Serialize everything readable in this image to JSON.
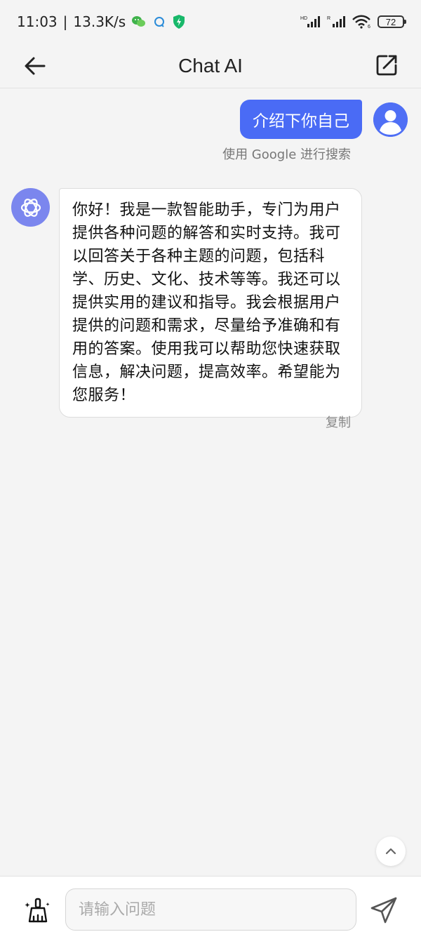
{
  "status_bar": {
    "time": "11:03",
    "separator": "|",
    "network_speed": "13.3K/s",
    "hd_label": "HD",
    "roaming_label": "R",
    "wifi_label": "6",
    "battery": "72"
  },
  "header": {
    "title": "Chat AI"
  },
  "chat": {
    "user_message": "介绍下你自己",
    "search_link": "使用 Google 进行搜索",
    "bot_message": "你好！我是一款智能助手，专门为用户提供各种问题的解答和实时支持。我可以回答关于各种主题的问题，包括科学、历史、文化、技术等等。我还可以提供实用的建议和指导。我会根据用户提供的问题和需求，尽量给予准确和有用的答案。使用我可以帮助您快速获取信息，解决问题，提高效率。希望能为您服务！",
    "copy_label": "复制"
  },
  "input": {
    "placeholder": "请输入问题",
    "value": ""
  },
  "colors": {
    "accent": "#4a6bf5",
    "bot_avatar": "#7b86ee",
    "background": "#f4f4f4"
  },
  "icons": {
    "back": "arrow-left-icon",
    "share": "share-external-icon",
    "bot": "openai-logo-icon",
    "user": "user-avatar-icon",
    "scroll_top": "chevron-up-icon",
    "clear": "broom-icon",
    "send": "send-icon"
  }
}
